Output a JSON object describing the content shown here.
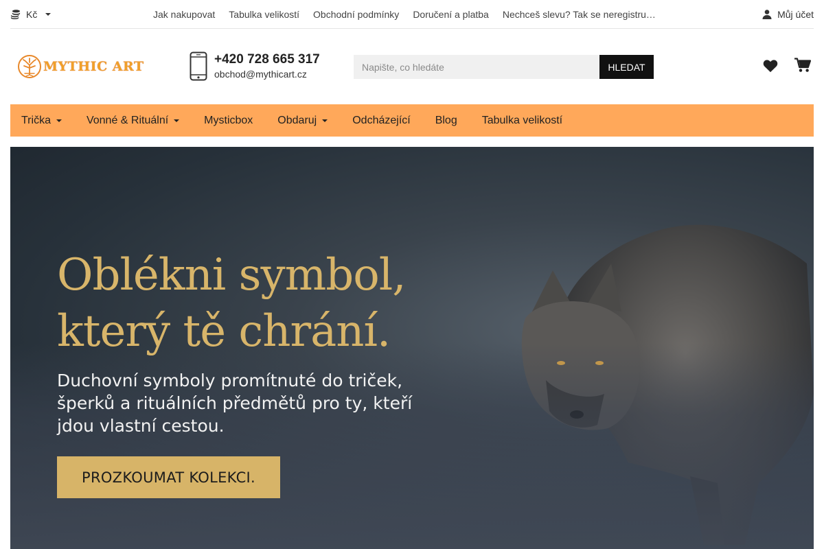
{
  "topbar": {
    "currency": "Kč",
    "links": [
      "Jak nakupovat",
      "Tabulka velikostí",
      "Obchodní podmínky",
      "Doručení a platba",
      "Nechceš slevu? Tak se neregistruj…"
    ],
    "account": "Můj účet"
  },
  "header": {
    "logo_text": "MYTHIC ART",
    "phone": "+420 728 665 317",
    "email": "obchod@mythicart.cz",
    "search_placeholder": "Napište, co hledáte",
    "search_button": "HLEDAT"
  },
  "nav": {
    "items": [
      {
        "label": "Trička",
        "dropdown": true
      },
      {
        "label": "Vonné & Rituální",
        "dropdown": true
      },
      {
        "label": "Mysticbox",
        "dropdown": false
      },
      {
        "label": "Obdaruj",
        "dropdown": true
      },
      {
        "label": "Odcházející",
        "dropdown": false
      },
      {
        "label": "Blog",
        "dropdown": false
      },
      {
        "label": "Tabulka velikostí",
        "dropdown": false
      }
    ]
  },
  "hero": {
    "headline_1": "Oblékni symbol,",
    "headline_2": "který tě chrání.",
    "sub_1": "Duchovní symboly promítnuté do triček,",
    "sub_2": "šperků a rituálních předmětů pro ty, kteří",
    "sub_3": "jdou vlastní cestou.",
    "cta": "PROZKOUMAT KOLEKCI."
  },
  "colors": {
    "nav_bg": "#ffa85a",
    "accent_gold": "#d7b468",
    "logo_orange": "#f0a02a"
  },
  "icons": [
    "coins-icon",
    "user-icon",
    "logo-tree-icon",
    "phone-icon",
    "heart-icon",
    "cart-icon"
  ]
}
